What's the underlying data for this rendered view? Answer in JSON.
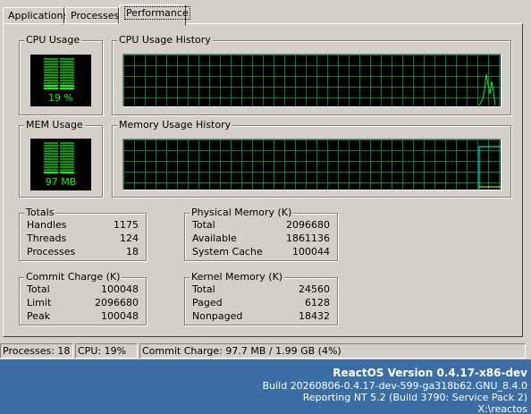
{
  "tabs": [
    {
      "label": "Applications"
    },
    {
      "label": "Processes"
    },
    {
      "label": "Performance"
    }
  ],
  "cpu": {
    "title": "CPU Usage",
    "value": "19 %",
    "history_title": "CPU Usage History"
  },
  "mem": {
    "title": "MEM Usage",
    "value": "97 MB",
    "history_title": "Memory Usage History"
  },
  "totals": {
    "title": "Totals",
    "rows": [
      {
        "label": "Handles",
        "value": "1175"
      },
      {
        "label": "Threads",
        "value": "124"
      },
      {
        "label": "Processes",
        "value": "18"
      }
    ]
  },
  "physical": {
    "title": "Physical Memory (K)",
    "rows": [
      {
        "label": "Total",
        "value": "2096680"
      },
      {
        "label": "Available",
        "value": "1861136"
      },
      {
        "label": "System Cache",
        "value": "100044"
      }
    ]
  },
  "commit": {
    "title": "Commit Charge (K)",
    "rows": [
      {
        "label": "Total",
        "value": "100048"
      },
      {
        "label": "Limit",
        "value": "2096680"
      },
      {
        "label": "Peak",
        "value": "100048"
      }
    ]
  },
  "kernel": {
    "title": "Kernel Memory (K)",
    "rows": [
      {
        "label": "Total",
        "value": "24560"
      },
      {
        "label": "Paged",
        "value": "6128"
      },
      {
        "label": "Nonpaged",
        "value": "18432"
      }
    ]
  },
  "statusbar": {
    "processes": "Processes: 18",
    "cpu": "CPU:  19%",
    "commit": "Commit Charge: 97.7 MB / 1.99 GB (4%)"
  },
  "os": {
    "version": "ReactOS Version 0.4.17-x86-dev",
    "build": "Build 20260806-0.4.17-dev-599-ga318b62.GNU_8.4.0",
    "reporting": "Reporting NT 5.2 (Build 3790: Service Pack 2)",
    "path": "X:\\reactos"
  },
  "colors": {
    "meter_on": "#00ff00",
    "meter_off": "#00a000",
    "grid": "#008040",
    "desktop": "#3a6ea5"
  },
  "history": {
    "cpu_percent": 19,
    "mem_percent": 4
  }
}
